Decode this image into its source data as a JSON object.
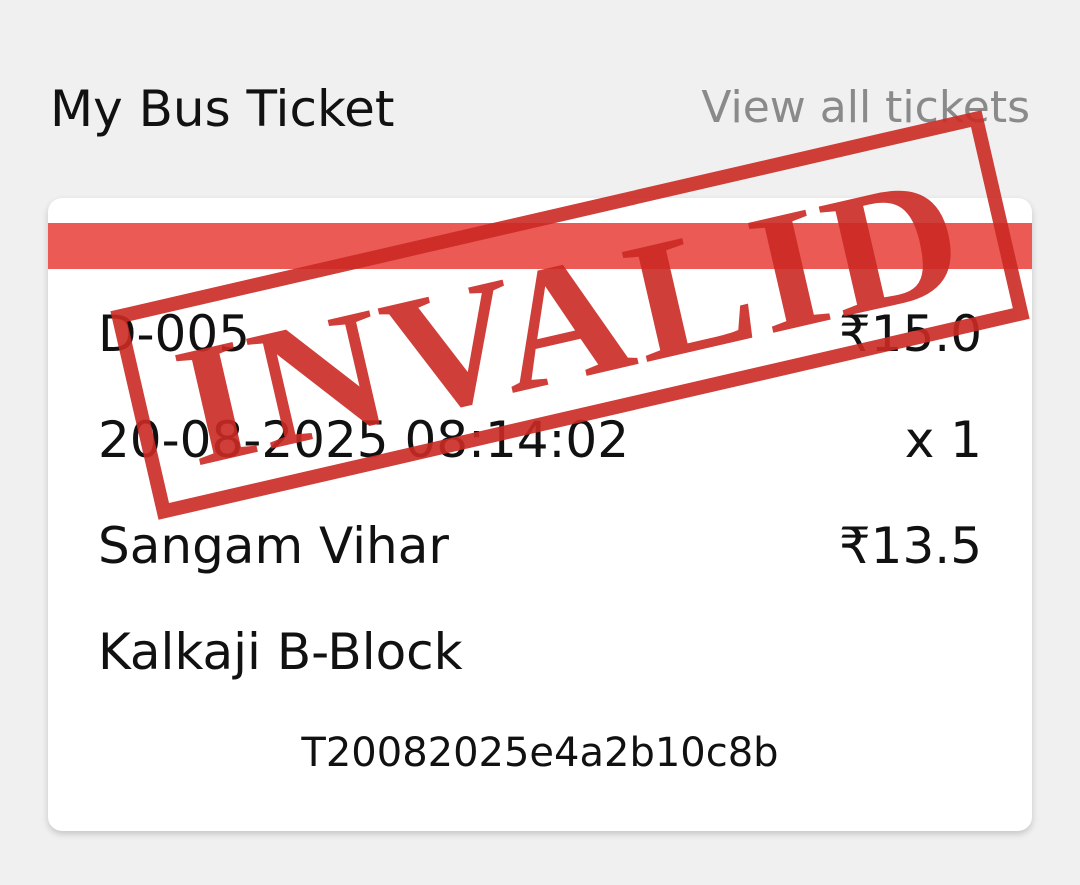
{
  "header": {
    "title": "My Bus Ticket",
    "view_all_label": "View all tickets"
  },
  "ticket": {
    "status_bar_color": "#eb5a55",
    "route": "D-005",
    "total_fare": "₹15.0",
    "datetime": "20-08-2025 08:14:02",
    "quantity": "x 1",
    "origin": "Sangam Vihar",
    "unit_fare": "₹13.5",
    "destination": "Kalkaji B-Block",
    "ticket_id": "T20082025e4a2b10c8b"
  },
  "stamp": {
    "text": "INVALID",
    "color": "#cc2a24"
  }
}
